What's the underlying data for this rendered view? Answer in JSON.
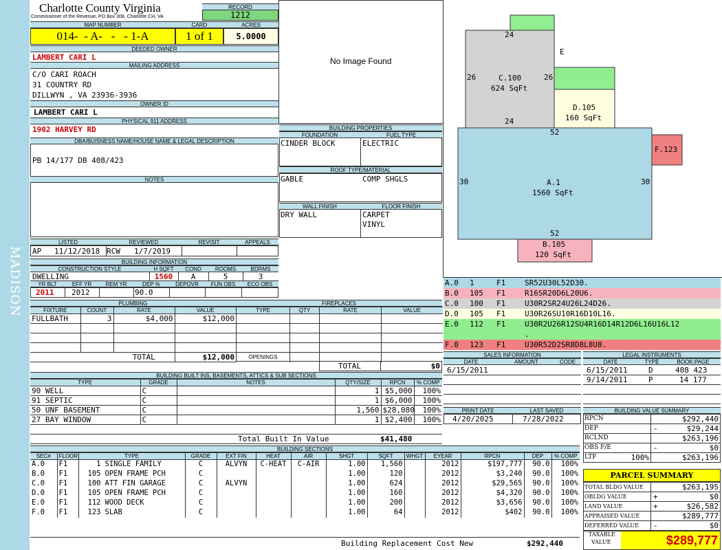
{
  "side_label": "MADISON",
  "header": {
    "county": "Charlotte County Virginia",
    "commissioner": "Commissioner of the Revenue, PO Box 308, Charlotte CH, VA",
    "record_label": "RECORD",
    "record": "1212",
    "map_number_label": "MAP NUMBER",
    "map_number": "014-  - A-   -   - 1-A",
    "card_label": "CARD",
    "card": "1 of 1",
    "acres_label": "ACRES",
    "acres": "5.0000"
  },
  "owner": {
    "deeded_owner_label": "DEEDED OWNER",
    "deeded_owner": "LAMBERT CARI L",
    "mailing_label": "MAILING ADDRESS",
    "mailing": [
      "C/O CARI ROACH",
      "31 COUNTRY RD",
      "DILLWYN , VA 23936-3936"
    ],
    "owner_id_label": "OWNER ID",
    "owner_id": "LAMBERT CARI L",
    "physical_label": "PHYSICAL 911 ADDRESS",
    "physical": "1902 HARVEY RD",
    "dba_label": "DBA/BUISNESS NAME/HOUSE NAME & LEGAL DESCRIPTION",
    "dba": "PB 14/177 DB 408/423",
    "notes_label": "NOTES"
  },
  "image": {
    "no_image": "No Image Found"
  },
  "review": {
    "labels": [
      "LISTED",
      "REVIEWED",
      "REVISIT",
      "APPEALS"
    ],
    "listed_by": "AP",
    "listed_date": "11/12/2018",
    "reviewed_by": "RCW",
    "reviewed_date": "1/7/2019"
  },
  "building_info": {
    "title": "BUILDING INFORMATION",
    "labels1": [
      "CONSTRUCTION STYLE",
      "H SQFT",
      "COND",
      "ROOMS",
      "BDRMS"
    ],
    "style": "DWELLING",
    "hsqft": "1560",
    "cond": "A",
    "rooms": "5",
    "bdrms": "3",
    "labels2": [
      "YR BLT",
      "EFF YR",
      "REM YR",
      "DEP %",
      "DEPOVR",
      "FUN OBS",
      "ECO OBS"
    ],
    "yr_blt": "2011",
    "eff_yr": "2012",
    "dep": "90.0"
  },
  "building_properties": {
    "title": "BUILDING PROPERTIES",
    "foundation_label": "FOUNDATION",
    "foundation": "CINDER BLOCK",
    "fuel_label": "FUEL TYPE",
    "fuel": "ELECTRIC",
    "roof_label": "ROOF TYPE/MATERIAL",
    "roof_type": "GABLE",
    "roof_material": "COMP SHGLS",
    "wall_label": "WALL FINISH",
    "wall": "DRY WALL",
    "floor_label": "FLOOR FINISH",
    "floor": [
      "CARPET",
      "VINYL"
    ]
  },
  "sketch": {
    "areas": [
      {
        "code": "C.100",
        "sqft": "624 SqFt"
      },
      {
        "code": "D.105",
        "sqft": "160 SqFt"
      },
      {
        "code": "E",
        "sqft": ""
      },
      {
        "code": "A.1",
        "sqft": "1560 SqFt"
      },
      {
        "code": "B.105",
        "sqft": "120 SqFt"
      },
      {
        "code": "F.123",
        "sqft": ""
      }
    ],
    "dims": [
      "24",
      "26",
      "26",
      "24",
      "52",
      "30",
      "30",
      "52"
    ],
    "legend": [
      {
        "sec": "A.0",
        "code": "1",
        "floor": "F1",
        "path": "SR52U30L52D30.",
        "color": "#add8e6"
      },
      {
        "sec": "B.0",
        "code": "105",
        "floor": "F1",
        "path": "R16SR20D6L20U6.",
        "color": "#f6b3be"
      },
      {
        "sec": "C.0",
        "code": "100",
        "floor": "F1",
        "path": "U30R2SR24U26L24D26.",
        "color": "#d3d3d3"
      },
      {
        "sec": "D.0",
        "code": "105",
        "floor": "F1",
        "path": "U30R26SU10R16D10L16.",
        "color": "#ffffe0"
      },
      {
        "sec": "E.0",
        "code": "112",
        "floor": "F1",
        "path": "U30R2U26R12SU4R16D14R12D6L16U16L12",
        "color": "#90ee90"
      },
      {
        "sec": "",
        "code": "",
        "floor": "",
        "path": ".",
        "color": "#90ee90"
      },
      {
        "sec": "F.0",
        "code": "123",
        "floor": "F1",
        "path": "U30R52D2SR8D8L8U8.",
        "color": "#f08080"
      }
    ]
  },
  "plumbing": {
    "title": "PLUMBING",
    "headers": [
      "FIXTURE",
      "COUNT",
      "RATE",
      "VALUE"
    ],
    "rows": [
      {
        "fixture": "FULLBATH",
        "count": "3",
        "rate": "$4,000",
        "value": "$12,000"
      }
    ],
    "total_label": "TOTAL",
    "total": "$12,000"
  },
  "fireplaces": {
    "title": "FIREPLACES",
    "headers": [
      "TYPE",
      "QTY",
      "RATE",
      "VALUE"
    ],
    "openings_label": "OPENINGS",
    "total_label": "TOTAL",
    "total": "$0"
  },
  "sales": {
    "title": "SALES INFORMATION",
    "headers": [
      "DATE",
      "AMOUNT",
      "CODE"
    ],
    "rows": [
      {
        "date": "6/15/2011",
        "amount": "",
        "code": ""
      }
    ]
  },
  "legal": {
    "title": "LEGAL INSTRUMENTS",
    "headers": [
      "DATE",
      "TYPE",
      "BOOK:PAGE"
    ],
    "rows": [
      {
        "date": "6/15/2011",
        "type": "D",
        "book": "408 423"
      },
      {
        "date": "9/14/2011",
        "type": "P",
        "book": "14 177"
      }
    ]
  },
  "dates": {
    "print_label": "PRINT DATE",
    "print": "4/20/2025",
    "saved_label": "LAST SAVED",
    "saved": "7/28/2022"
  },
  "built_ins": {
    "title": "BUILDING BUILT INS, BASEMENTS, ATTICS & SUB SECTIONS",
    "headers": [
      "TYPE",
      "GRADE",
      "NOTES",
      "QTY/SIZE",
      "RPCN",
      "% COMP"
    ],
    "rows": [
      {
        "type": "90 WELL",
        "grade": "C",
        "notes": "",
        "qty": "1",
        "rpcn": "$5,000",
        "comp": "100%"
      },
      {
        "type": "91 SEPTIC",
        "grade": "C",
        "notes": "",
        "qty": "1",
        "rpcn": "$6,000",
        "comp": "100%"
      },
      {
        "type": "50 UNF BASEMENT",
        "grade": "C",
        "notes": "",
        "qty": "1,560",
        "rpcn": "$28,080",
        "comp": "100%"
      },
      {
        "type": "27 BAY WINDOW",
        "grade": "C",
        "notes": "",
        "qty": "1",
        "rpcn": "$2,400",
        "comp": "100%"
      }
    ],
    "total_label": "Total Built In Value",
    "total": "$41,480"
  },
  "value_summary": {
    "title": "BUILDING VALUE SUMMARY",
    "rows": [
      {
        "label": "RPCN",
        "sign": "",
        "value": "$292,440"
      },
      {
        "label": "DEP",
        "sign": "-",
        "value": "$29,244"
      },
      {
        "label": "RCLND",
        "sign": "",
        "value": "$263,196"
      },
      {
        "label": "OBS F/E",
        "sign": "-",
        "value": "$0"
      },
      {
        "label": "LTF",
        "sign": "100%",
        "value": "$263,196"
      }
    ]
  },
  "parcel": {
    "title": "PARCEL SUMMARY",
    "rows": [
      {
        "label": "TOTAL BLDG VALUE",
        "sign": "",
        "value": "$263,195"
      },
      {
        "label": "OBLDG VALUE",
        "sign": "+",
        "value": "$0"
      },
      {
        "label": "LAND VALUE",
        "sign": "+",
        "value": "$26,582"
      },
      {
        "label": "APPRAISED VALUE",
        "sign": "",
        "value": "$289,777"
      },
      {
        "label": "DEFERRED VALUE",
        "sign": "-",
        "value": "$0"
      }
    ],
    "taxable_label_1": "TAXABLE",
    "taxable_label_2": "VALUE",
    "taxable": "$289,777"
  },
  "sections": {
    "title": "BUILDING SECTIONS",
    "headers": [
      "SEC#",
      "FLOOR",
      "TYPE",
      "GRADE",
      "EXT FIN",
      "HEAT",
      "AIR",
      "SHGT",
      "SQFT",
      "WHGT",
      "EYEAR",
      "RPCN",
      "DEP",
      "% COMP"
    ],
    "rows": [
      {
        "sec": "A.0",
        "floor": "F1",
        "code": "1",
        "type": "SINGLE FAMILY",
        "grade": "C",
        "ext": "ALVYN",
        "heat": "C-HEAT",
        "air": "C-AIR",
        "shgt": "1.00",
        "sqft": "1,560",
        "whgt": "",
        "eyear": "2012",
        "rpcn": "$197,777",
        "dep": "90.0",
        "comp": "100%"
      },
      {
        "sec": "B.0",
        "floor": "F1",
        "code": "105",
        "type": "OPEN FRAME PCH",
        "grade": "C",
        "ext": "",
        "heat": "",
        "air": "",
        "shgt": "1.00",
        "sqft": "120",
        "whgt": "",
        "eyear": "2012",
        "rpcn": "$3,240",
        "dep": "90.0",
        "comp": "100%"
      },
      {
        "sec": "C.0",
        "floor": "F1",
        "code": "100",
        "type": "ATT FIN GARAGE",
        "grade": "C",
        "ext": "ALVYN",
        "heat": "",
        "air": "",
        "shgt": "1.00",
        "sqft": "624",
        "whgt": "",
        "eyear": "2012",
        "rpcn": "$29,565",
        "dep": "90.0",
        "comp": "100%"
      },
      {
        "sec": "D.0",
        "floor": "F1",
        "code": "105",
        "type": "OPEN FRAME PCH",
        "grade": "C",
        "ext": "",
        "heat": "",
        "air": "",
        "shgt": "1.00",
        "sqft": "160",
        "whgt": "",
        "eyear": "2012",
        "rpcn": "$4,320",
        "dep": "90.0",
        "comp": "100%"
      },
      {
        "sec": "E.0",
        "floor": "F1",
        "code": "112",
        "type": "WOOD DECK",
        "grade": "C",
        "ext": "",
        "heat": "",
        "air": "",
        "shgt": "1.00",
        "sqft": "200",
        "whgt": "",
        "eyear": "2012",
        "rpcn": "$3,656",
        "dep": "90.0",
        "comp": "100%"
      },
      {
        "sec": "F.0",
        "floor": "F1",
        "code": "123",
        "type": "SLAB",
        "grade": "C",
        "ext": "",
        "heat": "",
        "air": "",
        "shgt": "1.00",
        "sqft": "64",
        "whgt": "",
        "eyear": "2012",
        "rpcn": "$402",
        "dep": "90.0",
        "comp": "100%"
      }
    ],
    "total_label": "Building Replacement Cost New",
    "total": "$292,440"
  }
}
